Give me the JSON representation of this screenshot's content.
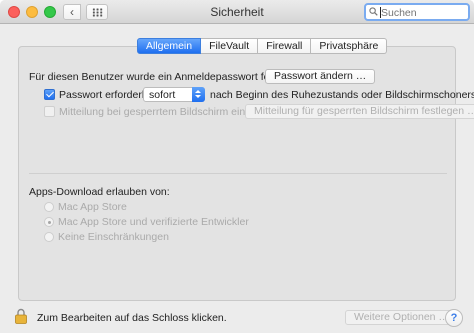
{
  "window": {
    "title": "Sicherheit",
    "nav_back": "‹",
    "nav_forward": "›",
    "search_placeholder": "Suchen"
  },
  "tabs": [
    {
      "label": "Allgemein",
      "active": true
    },
    {
      "label": "FileVault",
      "active": false
    },
    {
      "label": "Firewall",
      "active": false
    },
    {
      "label": "Privatsphäre",
      "active": false
    }
  ],
  "general": {
    "password_label": "Für diesen Benutzer wurde ein Anmeldepasswort festgelegt",
    "change_password_button": "Passwort ändern …",
    "require_password_label": "Passwort erforderlich",
    "require_password_checked": true,
    "require_password_select": "sofort",
    "after_sleep_label": "nach Beginn des Ruhezustands oder Bildschirmschoners",
    "lock_message_label": "Mitteilung bei gesperrtem Bildschirm einblenden",
    "lock_message_checked": false,
    "lock_message_button": "Mitteilung für gesperrten Bildschirm festlegen …"
  },
  "apps_download": {
    "heading": "Apps-Download erlauben von:",
    "options": [
      {
        "label": "Mac App Store",
        "selected": false
      },
      {
        "label": "Mac App Store und verifizierte Entwickler",
        "selected": true
      },
      {
        "label": "Keine Einschränkungen",
        "selected": false
      }
    ]
  },
  "footer": {
    "lock_label": "Zum Bearbeiten auf das Schloss klicken.",
    "advanced_button": "Weitere Optionen …",
    "help_button": "?"
  },
  "colors": {
    "accent": "#1f6ff0",
    "window_bg": "#ececec",
    "panel_bg": "#e3e3e3"
  },
  "icons": [
    "back-arrow",
    "forward-arrow",
    "grid-icon",
    "search-icon",
    "lock-icon",
    "help-icon"
  ]
}
